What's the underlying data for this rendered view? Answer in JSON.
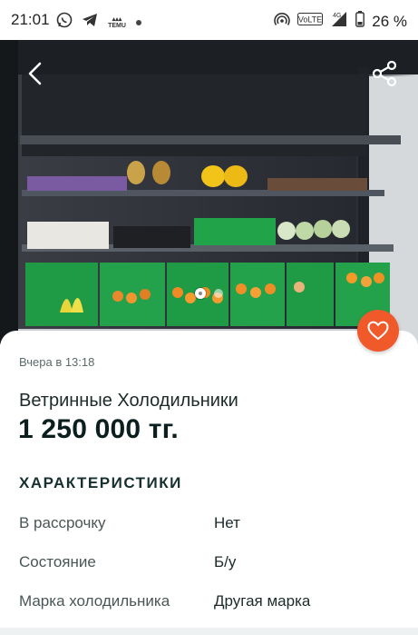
{
  "status_bar": {
    "time": "21:01",
    "battery_percent": "26 %",
    "temu_label": "TEMU",
    "icons": [
      "whatsapp-icon",
      "telegram-icon",
      "temu-icon",
      "notification-dot-icon",
      "hotspot-icon",
      "volte-icon",
      "signal-4g-icon",
      "battery-icon"
    ]
  },
  "toolbar": {
    "back_icon": "chevron-left-icon",
    "share_icon": "share-icon"
  },
  "gallery": {
    "description_icon": "product-photo",
    "dot_count": 2,
    "active_index": 0
  },
  "listing": {
    "posted_at": "Вчера в 13:18",
    "title": "Ветринные Холодильники",
    "price": "1 250 000 тг.",
    "favorite_icon": "heart-icon"
  },
  "specs": {
    "heading": "ХАРАКТЕРИСТИКИ",
    "rows": [
      {
        "label": "В рассрочку",
        "value": "Нет"
      },
      {
        "label": "Состояние",
        "value": "Б/у"
      },
      {
        "label": "Марка холодильника",
        "value": "Другая марка"
      }
    ]
  },
  "colors": {
    "accent": "#f05a2b",
    "text_dark": "#0c1f1f"
  }
}
